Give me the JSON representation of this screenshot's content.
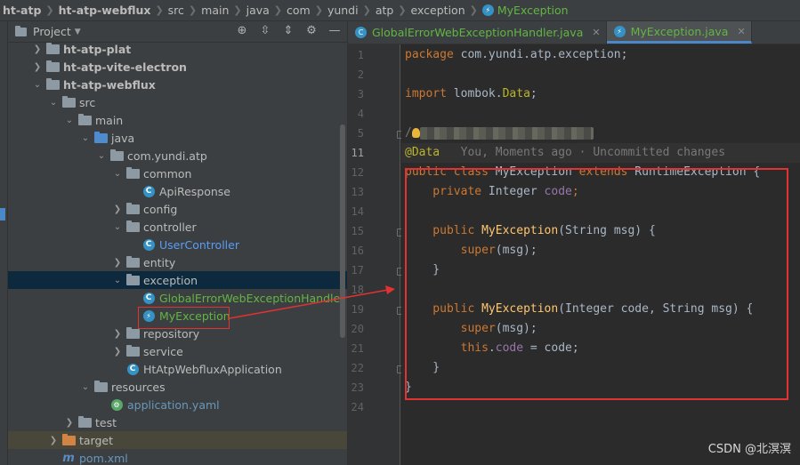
{
  "breadcrumb": {
    "items": [
      "ht-atp",
      "ht-atp-webflux",
      "src",
      "main",
      "java",
      "com",
      "yundi",
      "atp",
      "exception"
    ],
    "current": "MyException"
  },
  "project_panel": {
    "title": "Project",
    "tree": [
      {
        "label": "ht-atp-plat",
        "kind": "module",
        "expanded": false
      },
      {
        "label": "ht-atp-vite-electron",
        "kind": "module",
        "expanded": false
      },
      {
        "label": "ht-atp-webflux",
        "kind": "module",
        "expanded": true
      },
      {
        "label": "src",
        "kind": "folder",
        "expanded": true
      },
      {
        "label": "main",
        "kind": "folder",
        "expanded": true
      },
      {
        "label": "java",
        "kind": "source-folder",
        "expanded": true
      },
      {
        "label": "com.yundi.atp",
        "kind": "package",
        "expanded": true
      },
      {
        "label": "common",
        "kind": "package",
        "expanded": true
      },
      {
        "label": "ApiResponse",
        "kind": "class"
      },
      {
        "label": "config",
        "kind": "package",
        "expanded": false
      },
      {
        "label": "controller",
        "kind": "package",
        "expanded": true
      },
      {
        "label": "UserController",
        "kind": "class"
      },
      {
        "label": "entity",
        "kind": "package",
        "expanded": false
      },
      {
        "label": "exception",
        "kind": "package",
        "expanded": true
      },
      {
        "label": "GlobalErrorWebExceptionHandler",
        "kind": "class"
      },
      {
        "label": "MyException",
        "kind": "exception-class"
      },
      {
        "label": "repository",
        "kind": "package",
        "expanded": false
      },
      {
        "label": "service",
        "kind": "package",
        "expanded": false
      },
      {
        "label": "HtAtpWebfluxApplication",
        "kind": "app-class"
      },
      {
        "label": "resources",
        "kind": "resource-folder",
        "expanded": true
      },
      {
        "label": "application.yaml",
        "kind": "yaml"
      },
      {
        "label": "test",
        "kind": "folder",
        "expanded": false
      },
      {
        "label": "target",
        "kind": "excluded-folder",
        "expanded": false
      },
      {
        "label": "pom.xml",
        "kind": "maven"
      }
    ]
  },
  "editor": {
    "tabs": [
      {
        "label": "GlobalErrorWebExceptionHandler.java",
        "active": false
      },
      {
        "label": "MyException.java",
        "active": true
      }
    ],
    "line_numbers": [
      "1",
      "2",
      "3",
      "4",
      "5",
      "11",
      "12",
      "13",
      "14",
      "15",
      "16",
      "17",
      "18",
      "19",
      "20",
      "21",
      "22",
      "23",
      "24"
    ],
    "current_line": "11",
    "code": {
      "l1": {
        "kw": "package",
        "rest": " com.yundi.atp.exception;"
      },
      "l3": {
        "kw": "import",
        "rest": " lombok.",
        "ann": "Data",
        "end": ";"
      },
      "l5": {
        "prefix": "/"
      },
      "l11": {
        "ann": "@Data",
        "hint": "   You, Moments ago · Uncommitted changes"
      },
      "l12": {
        "kw1": "public",
        "kw2": " class",
        "name": " MyException",
        "kw3": " extends",
        "rest": " RuntimeException {"
      },
      "l13": {
        "kw": "    private",
        "type": " Integer",
        "fld": " code",
        "end": ";"
      },
      "l15": {
        "kw": "    public",
        "mth": " MyException",
        "rest": "(String msg) {"
      },
      "l16": {
        "kw": "        super",
        "rest": "(msg);"
      },
      "l17": {
        "rest": "    }"
      },
      "l19": {
        "kw": "    public",
        "mth": " MyException",
        "rest": "(Integer code, String msg) {"
      },
      "l20": {
        "kw": "        super",
        "rest": "(msg);"
      },
      "l21": {
        "kw": "        this",
        "dot": ".",
        "fld": "code",
        "rest": " = code;"
      },
      "l22": {
        "rest": "    }"
      },
      "l23": {
        "rest": "}"
      }
    }
  },
  "watermark": "CSDN @北溟溟",
  "colors": {
    "annotation_red": "#e33232",
    "accent_blue": "#4a88c7"
  }
}
